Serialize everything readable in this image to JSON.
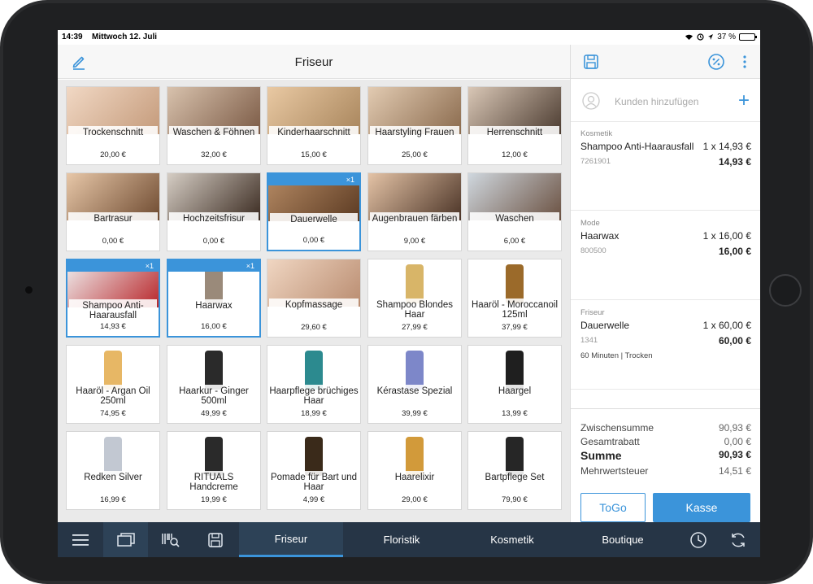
{
  "status_bar": {
    "time": "14:39",
    "date": "Mittwoch 12. Juli",
    "battery": "37 %",
    "battery_level": 0.37
  },
  "header": {
    "title": "Friseur"
  },
  "products": [
    {
      "name": "Trockenschnitt",
      "price": "20,00 €",
      "badge": "",
      "img": [
        "#f1d8c4",
        "#c49a7a"
      ]
    },
    {
      "name": "Waschen & Föhnen",
      "price": "32,00 €",
      "badge": "",
      "img": [
        "#d8c2ad",
        "#7b5a45"
      ]
    },
    {
      "name": "Kinderhaarschnitt",
      "price": "15,00 €",
      "badge": "",
      "img": [
        "#e9c9a3",
        "#a8855c"
      ]
    },
    {
      "name": "Haarstyling Frauen",
      "price": "25,00 €",
      "badge": "",
      "img": [
        "#e2cbb2",
        "#8a6a4d"
      ]
    },
    {
      "name": "Herrenschnitt",
      "price": "12,00 €",
      "badge": "",
      "img": [
        "#d9c7b6",
        "#4b3b30"
      ]
    },
    {
      "name": "Bartrasur",
      "price": "0,00 €",
      "badge": "",
      "img": [
        "#e7c7a8",
        "#6e4a30"
      ]
    },
    {
      "name": "Hochzeitsfrisur",
      "price": "0,00 €",
      "badge": "",
      "img": [
        "#d5cdc4",
        "#3a2a20"
      ]
    },
    {
      "name": "Dauerwelle",
      "price": "0,00 €",
      "badge": "×1",
      "img": [
        "#b58a64",
        "#5b3a22"
      ]
    },
    {
      "name": "Augenbrauen färben",
      "price": "9,00 €",
      "badge": "",
      "img": [
        "#e4c3a6",
        "#4a3326"
      ]
    },
    {
      "name": "Waschen",
      "price": "6,00 €",
      "badge": "",
      "img": [
        "#cfd7de",
        "#6a5040"
      ]
    },
    {
      "name": "Shampoo Anti-Haarausfall",
      "price": "14,93 €",
      "badge": "×1",
      "img": [
        "#f0f0f0",
        "#b8262a"
      ]
    },
    {
      "name": "Haarwax",
      "price": "16,00 €",
      "badge": "×1",
      "img": [
        "#ffffff",
        "#9a8a7a"
      ]
    },
    {
      "name": "Kopfmassage",
      "price": "29,60 €",
      "badge": "",
      "img": [
        "#f0d6c2",
        "#b98c70"
      ]
    },
    {
      "name": "Shampoo Blondes Haar",
      "price": "27,99 €",
      "badge": "",
      "img": [
        "#ffffff",
        "#d8b568"
      ]
    },
    {
      "name": "Haaröl - Moroccanoil 125ml",
      "price": "37,99 €",
      "badge": "",
      "img": [
        "#ffffff",
        "#9b6a2a"
      ]
    },
    {
      "name": "Haaröl - Argan Oil 250ml",
      "price": "74,95 €",
      "badge": "",
      "img": [
        "#ffffff",
        "#e7b765"
      ]
    },
    {
      "name": "Haarkur - Ginger 500ml",
      "price": "49,99 €",
      "badge": "",
      "img": [
        "#ffffff",
        "#2a2a2a"
      ]
    },
    {
      "name": "Haarpflege brüchiges Haar",
      "price": "18,99 €",
      "badge": "",
      "img": [
        "#ffffff",
        "#2c8a8f"
      ]
    },
    {
      "name": "Kérastase Spezial",
      "price": "39,99 €",
      "badge": "",
      "img": [
        "#ffffff",
        "#7d87c9"
      ]
    },
    {
      "name": "Haargel",
      "price": "13,99 €",
      "badge": "",
      "img": [
        "#ffffff",
        "#1f1f1f"
      ]
    },
    {
      "name": "Redken Silver",
      "price": "16,99 €",
      "badge": "",
      "img": [
        "#ffffff",
        "#c2c8d2"
      ]
    },
    {
      "name": "RITUALS Handcreme",
      "price": "19,99 €",
      "badge": "",
      "img": [
        "#ffffff",
        "#2a2a2a"
      ]
    },
    {
      "name": "Pomade für Bart und Haar",
      "price": "4,99 €",
      "badge": "",
      "img": [
        "#ffffff",
        "#3a2a1a"
      ]
    },
    {
      "name": "Haarelixir",
      "price": "29,00 €",
      "badge": "",
      "img": [
        "#ffffff",
        "#d29a3a"
      ]
    },
    {
      "name": "Bartpflege Set",
      "price": "79,90 €",
      "badge": "",
      "img": [
        "#ffffff",
        "#262626"
      ]
    }
  ],
  "customer": {
    "placeholder": "Kunden hinzufügen"
  },
  "cart": [
    {
      "category": "Kosmetik",
      "name": "Shampoo Anti-Haarausfall",
      "qty": "1 x 14,93 €",
      "sku": "7261901",
      "total": "14,93 €",
      "note": ""
    },
    {
      "category": "Mode",
      "name": "Haarwax",
      "qty": "1 x 16,00 €",
      "sku": "800500",
      "total": "16,00 €",
      "note": ""
    },
    {
      "category": "Friseur",
      "name": "Dauerwelle",
      "qty": "1 x 60,00 €",
      "sku": "1341",
      "total": "60,00 €",
      "note": "60 Minuten | Trocken"
    }
  ],
  "totals": {
    "subtotal_label": "Zwischensumme",
    "subtotal": "90,93 €",
    "discount_label": "Gesamtrabatt",
    "discount": "0,00 €",
    "sum_label": "Summe",
    "sum": "90,93 €",
    "tax_label": "Mehrwertsteuer",
    "tax": "14,51 €"
  },
  "actions": {
    "togo": "ToGo",
    "kasse": "Kasse"
  },
  "bottom_tabs": [
    "Friseur",
    "Floristik",
    "Kosmetik",
    "Boutique"
  ],
  "colors": {
    "accent": "#3b94da",
    "bottom_bar": "#263546"
  }
}
